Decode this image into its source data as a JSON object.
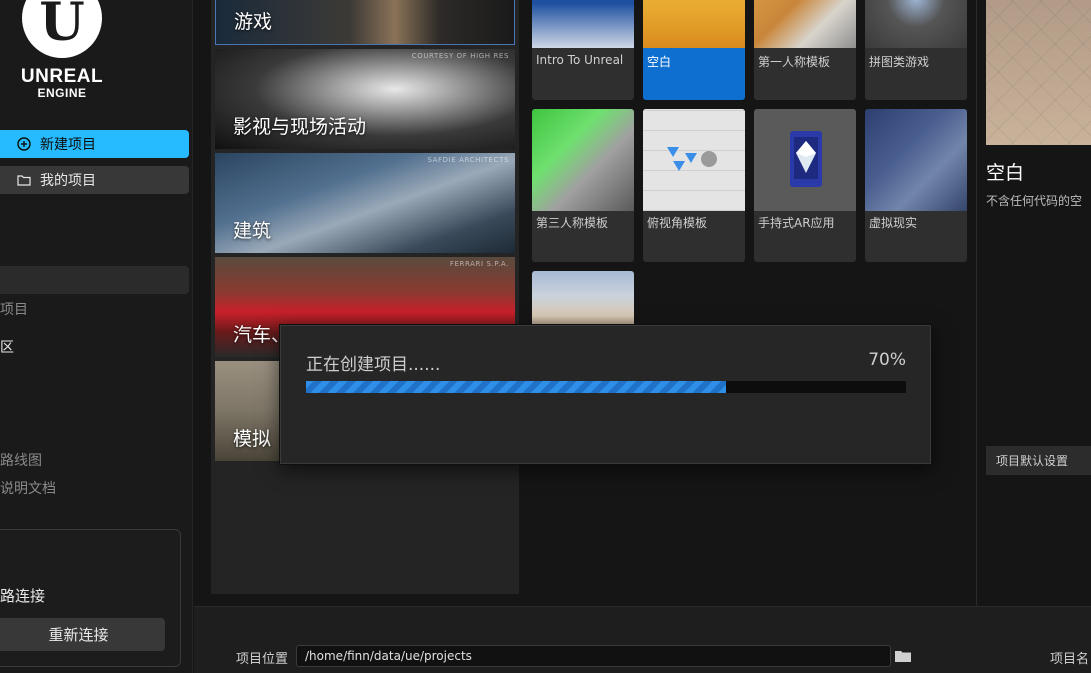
{
  "brand": {
    "line1": "UNREAL",
    "line2": "ENGINE"
  },
  "sidebar": {
    "new_project": "新建项目",
    "my_projects": "我的项目",
    "item_project": "项目",
    "item_area": "区",
    "item_roadmap": "路线图",
    "item_docs": "说明文档",
    "connection_text": "路连接",
    "reconnect": "重新连接"
  },
  "categories": [
    {
      "label": "游戏",
      "credit": ""
    },
    {
      "label": "影视与现场活动",
      "credit": "COURTESY OF HIGH RES"
    },
    {
      "label": "建筑",
      "credit": "SAFDIE ARCHITECTS"
    },
    {
      "label": "汽车、",
      "credit": "FERRARI S.P.A."
    },
    {
      "label": "模拟",
      "credit": ""
    }
  ],
  "templates": [
    {
      "label": "Intro To Unreal",
      "selected": false
    },
    {
      "label": "空白",
      "selected": true
    },
    {
      "label": "第一人称模板",
      "selected": false
    },
    {
      "label": "拼图类游戏",
      "selected": false
    },
    {
      "label": "第三人称模板",
      "selected": false
    },
    {
      "label": "俯视角模板",
      "selected": false
    },
    {
      "label": "手持式AR应用",
      "selected": false
    },
    {
      "label": "虚拟现实",
      "selected": false
    },
    {
      "label": "",
      "selected": false
    }
  ],
  "details": {
    "title": "空白",
    "description": "不含任何代码的空",
    "settings_label": "项目默认设置"
  },
  "bottom": {
    "location_label": "项目位置",
    "location_value": "/home/finn/data/ue/projects",
    "name_label": "项目名"
  },
  "progress": {
    "text": "正在创建项目......",
    "percent_label": "70%",
    "value": 0.7
  },
  "colors": {
    "accent": "#26bbff",
    "selected_tile": "#0e6fd1",
    "progress": "#2f8fe8"
  }
}
